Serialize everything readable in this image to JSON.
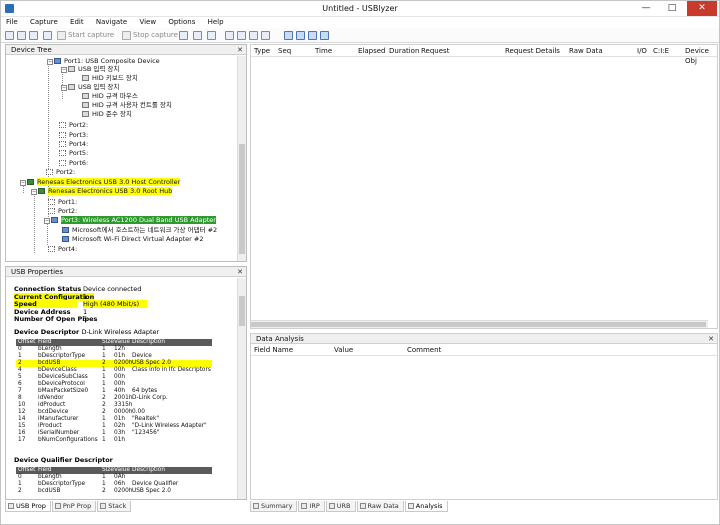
{
  "title_bar": {
    "title": "Untitled - USBlyzer",
    "minimize": "—",
    "maximize": "□",
    "close": "✕"
  },
  "menu": [
    "File",
    "Capture",
    "Edit",
    "Navigate",
    "View",
    "Options",
    "Help"
  ],
  "toolbar": {
    "start_capture": "Start capture",
    "stop_capture": "Stop capture"
  },
  "device_tree": {
    "title": "Device Tree",
    "close": "✕",
    "items": [
      "Port1: USB Composite Device",
      "USB 입력 장치",
      "HID 키보드 장치",
      "USB 입력 장치",
      "HID 규격 마우스",
      "HID 규격 사용자 컨트롤 장치",
      "HID 준수 장치",
      "Port2:",
      "Port3:",
      "Port4:",
      "Port5:",
      "Port6:",
      "Port2:",
      "Renesas Electronics USB 3.0 Host Controller",
      "Renesas Electronics USB 3.0 Root Hub",
      "Port1:",
      "Port2:",
      "Port3: Wireless AC1200 Dual Band USB Adapter",
      "Microsoft에서 호스트하는 네트워크 가상 어댑터 #2",
      "Microsoft Wi-Fi Direct Virtual Adapter #2",
      "Port4:"
    ]
  },
  "usb_properties": {
    "title": "USB Properties",
    "close": "✕",
    "summary": [
      {
        "key": "Connection Status",
        "value": "Device connected"
      },
      {
        "key": "Current Configuration",
        "value": "1"
      },
      {
        "key": "Speed",
        "value": "High (480 Mbit/s)"
      },
      {
        "key": "Device Address",
        "value": "1"
      },
      {
        "key": "Number Of Open Pipes",
        "value": "5"
      }
    ],
    "device_descriptor_label": "Device Descriptor",
    "device_descriptor_name": "D-Link Wireless Adapter",
    "table_headers": [
      "Offset",
      "Field",
      "Size",
      "Value",
      "Description"
    ],
    "device_descriptor": [
      [
        "0",
        "bLength",
        "1",
        "12h",
        ""
      ],
      [
        "1",
        "bDescriptorType",
        "1",
        "01h",
        "Device"
      ],
      [
        "2",
        "bcdUSB",
        "2",
        "0200h",
        "USB Spec 2.0"
      ],
      [
        "4",
        "bDeviceClass",
        "1",
        "00h",
        "Class info in Ifc Descriptors"
      ],
      [
        "5",
        "bDeviceSubClass",
        "1",
        "00h",
        ""
      ],
      [
        "6",
        "bDeviceProtocol",
        "1",
        "00h",
        ""
      ],
      [
        "7",
        "bMaxPacketSize0",
        "1",
        "40h",
        "64 bytes"
      ],
      [
        "8",
        "idVendor",
        "2",
        "2001h",
        "D-Link Corp."
      ],
      [
        "10",
        "idProduct",
        "2",
        "3315h",
        ""
      ],
      [
        "12",
        "bcdDevice",
        "2",
        "0000h",
        "0.00"
      ],
      [
        "14",
        "iManufacturer",
        "1",
        "01h",
        "\"Realtek\""
      ],
      [
        "15",
        "iProduct",
        "1",
        "02h",
        "\"D-Link Wireless Adapter\""
      ],
      [
        "16",
        "iSerialNumber",
        "1",
        "03h",
        "\"123456\""
      ],
      [
        "17",
        "bNumConfigurations",
        "1",
        "01h",
        ""
      ]
    ],
    "qualifier_label": "Device Qualifier Descriptor",
    "qualifier": [
      [
        "0",
        "bLength",
        "1",
        "0Ah",
        ""
      ],
      [
        "1",
        "bDescriptorType",
        "1",
        "06h",
        "Device Qualifier"
      ],
      [
        "2",
        "bcdUSB",
        "2",
        "0200h",
        "USB Spec 2.0"
      ]
    ]
  },
  "capture_grid": {
    "columns": [
      "Type",
      "Seq",
      "Time",
      "Elapsed",
      "Duration",
      "Request",
      "Request Details",
      "Raw Data",
      "I/O",
      "C:I:E",
      "Device Obj"
    ]
  },
  "data_analysis": {
    "title": "Data Analysis",
    "close": "✕",
    "columns": [
      "Field Name",
      "Value",
      "Comment"
    ]
  },
  "left_tabs": [
    "USB Prop",
    "PnP Prop",
    "Stack"
  ],
  "right_tabs": [
    "Summary",
    "IRP",
    "URB",
    "Raw Data",
    "Analysis"
  ],
  "colors": {
    "highlight": "#ffff00",
    "selection": "#2c9a2c",
    "close_button": "#c63b2b"
  }
}
